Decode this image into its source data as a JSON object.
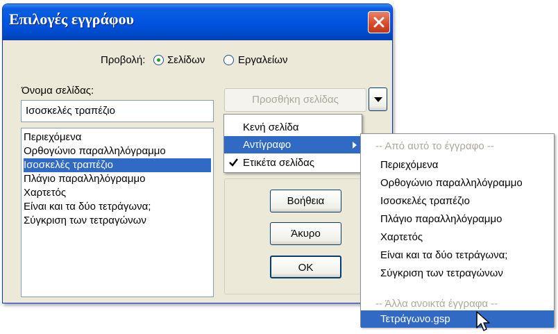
{
  "window": {
    "title": "Επιλογές εγγράφου"
  },
  "view": {
    "label": "Προβολή:",
    "options": [
      {
        "label": "Σελίδων",
        "selected": true
      },
      {
        "label": "Εργαλείων",
        "selected": false
      }
    ]
  },
  "page_name": {
    "label": "Όνομα σελίδας:",
    "value": "Ισοσκελές τραπέζιο"
  },
  "pages": {
    "items": [
      "Περιεχόμενα",
      "Ορθογώνιο παραλληλόγραμμο",
      "Ισοσκελές τραπέζιο",
      "Πλάγιο παραλληλόγραμμο",
      "Χαρτετός",
      "Είναι και τα δύο τετράγωνα;",
      "Σύγκριση των τετραγώνων"
    ],
    "selected_index": 2
  },
  "add_page": {
    "label": "Προσθήκη σελίδας",
    "arrow_icon": "dropdown-arrow-icon"
  },
  "add_menu": {
    "items": [
      "Κενή σελίδα",
      "Αντίγραφο"
    ],
    "highlighted_index": 1
  },
  "page_tab": {
    "label": "Ετικέτα σελίδας",
    "checked": true
  },
  "buttons": {
    "help": "Βοήθεια",
    "cancel": "Άκυρο",
    "ok": "ΟΚ"
  },
  "copy_submenu": {
    "header_this": "-- Από αυτό το έγγραφο --",
    "items": [
      "Περιεχόμενα",
      "Ορθογώνιο παραλληλόγραμμο",
      "Ισοσκελές τραπέζιο",
      "Πλάγιο παραλληλόγραμμο",
      "Χαρτετός",
      "Είναι και τα δύο τετράγωνα;",
      "Σύγκριση των τετραγώνων"
    ],
    "header_other": "-- Άλλα ανοικτά έγγραφα --",
    "other_documents": [
      "Τετράγωνο.gsp"
    ]
  },
  "colors": {
    "title_bar": "#0054e3",
    "selection": "#316ac5",
    "dialog_face": "#ece9d8",
    "close_button": "#d8492a"
  }
}
